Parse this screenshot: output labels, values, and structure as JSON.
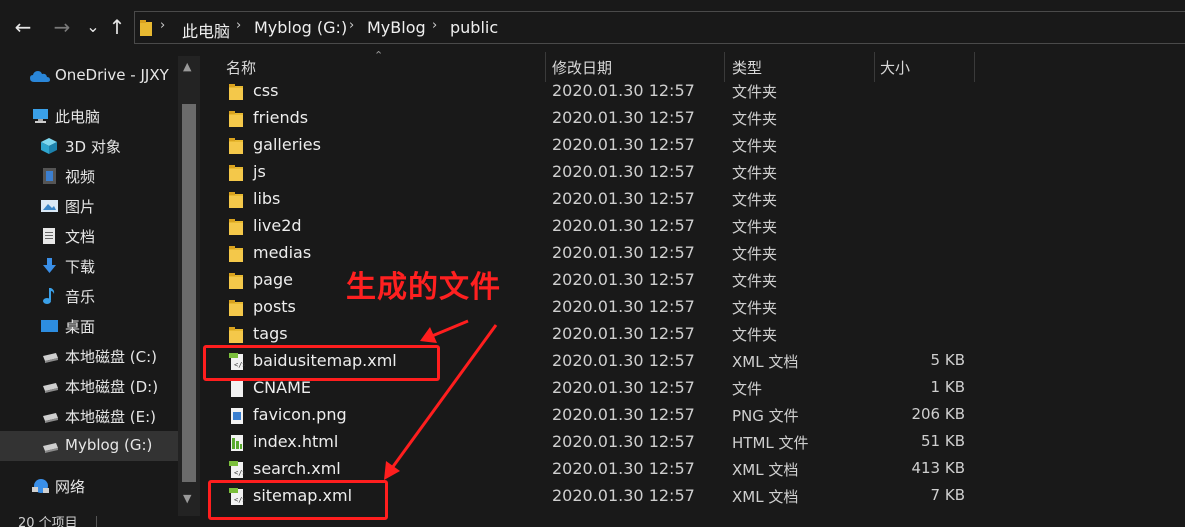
{
  "nav": {
    "back": "←",
    "forward": "→",
    "recent": "⌄",
    "up": "↑"
  },
  "address": {
    "crumbs": [
      "此电脑",
      "Myblog (G:)",
      "MyBlog",
      "public"
    ]
  },
  "sidebar": {
    "items": [
      {
        "label": "OneDrive - JJXY",
        "icon": "onedrive-cloud-icon"
      },
      {
        "label": "此电脑",
        "icon": "this-pc-icon"
      },
      {
        "label": "3D 对象",
        "icon": "3d-objects-icon"
      },
      {
        "label": "视频",
        "icon": "videos-icon"
      },
      {
        "label": "图片",
        "icon": "pictures-icon"
      },
      {
        "label": "文档",
        "icon": "documents-icon"
      },
      {
        "label": "下载",
        "icon": "downloads-icon"
      },
      {
        "label": "音乐",
        "icon": "music-icon"
      },
      {
        "label": "桌面",
        "icon": "desktop-icon"
      },
      {
        "label": "本地磁盘 (C:)",
        "icon": "drive-icon"
      },
      {
        "label": "本地磁盘 (D:)",
        "icon": "drive-icon"
      },
      {
        "label": "本地磁盘 (E:)",
        "icon": "drive-icon"
      },
      {
        "label": "Myblog (G:)",
        "icon": "drive-icon",
        "selected": true
      },
      {
        "label": "网络",
        "icon": "network-icon"
      }
    ]
  },
  "columns": {
    "name": "名称",
    "date": "修改日期",
    "type": "类型",
    "size": "大小"
  },
  "files": [
    {
      "name": "css",
      "date": "2020.01.30 12:57",
      "type": "文件夹",
      "size": "",
      "icon": "folder-icon"
    },
    {
      "name": "friends",
      "date": "2020.01.30 12:57",
      "type": "文件夹",
      "size": "",
      "icon": "folder-icon"
    },
    {
      "name": "galleries",
      "date": "2020.01.30 12:57",
      "type": "文件夹",
      "size": "",
      "icon": "folder-icon"
    },
    {
      "name": "js",
      "date": "2020.01.30 12:57",
      "type": "文件夹",
      "size": "",
      "icon": "folder-icon"
    },
    {
      "name": "libs",
      "date": "2020.01.30 12:57",
      "type": "文件夹",
      "size": "",
      "icon": "folder-icon"
    },
    {
      "name": "live2d",
      "date": "2020.01.30 12:57",
      "type": "文件夹",
      "size": "",
      "icon": "folder-icon"
    },
    {
      "name": "medias",
      "date": "2020.01.30 12:57",
      "type": "文件夹",
      "size": "",
      "icon": "folder-icon"
    },
    {
      "name": "page",
      "date": "2020.01.30 12:57",
      "type": "文件夹",
      "size": "",
      "icon": "folder-icon"
    },
    {
      "name": "posts",
      "date": "2020.01.30 12:57",
      "type": "文件夹",
      "size": "",
      "icon": "folder-icon"
    },
    {
      "name": "tags",
      "date": "2020.01.30 12:57",
      "type": "文件夹",
      "size": "",
      "icon": "folder-icon"
    },
    {
      "name": "baidusitemap.xml",
      "date": "2020.01.30 12:57",
      "type": "XML 文档",
      "size": "5 KB",
      "icon": "xml-file-icon"
    },
    {
      "name": "CNAME",
      "date": "2020.01.30 12:57",
      "type": "文件",
      "size": "1 KB",
      "icon": "blank-file-icon"
    },
    {
      "name": "favicon.png",
      "date": "2020.01.30 12:57",
      "type": "PNG 文件",
      "size": "206 KB",
      "icon": "image-file-icon"
    },
    {
      "name": "index.html",
      "date": "2020.01.30 12:57",
      "type": "HTML 文件",
      "size": "51 KB",
      "icon": "html-file-icon"
    },
    {
      "name": "search.xml",
      "date": "2020.01.30 12:57",
      "type": "XML 文档",
      "size": "413 KB",
      "icon": "xml-file-icon"
    },
    {
      "name": "sitemap.xml",
      "date": "2020.01.30 12:57",
      "type": "XML 文档",
      "size": "7 KB",
      "icon": "xml-file-icon"
    }
  ],
  "status": {
    "count": "20 个项目"
  },
  "annotation": {
    "text": "生成的文件",
    "color": "#ff1e1e"
  }
}
